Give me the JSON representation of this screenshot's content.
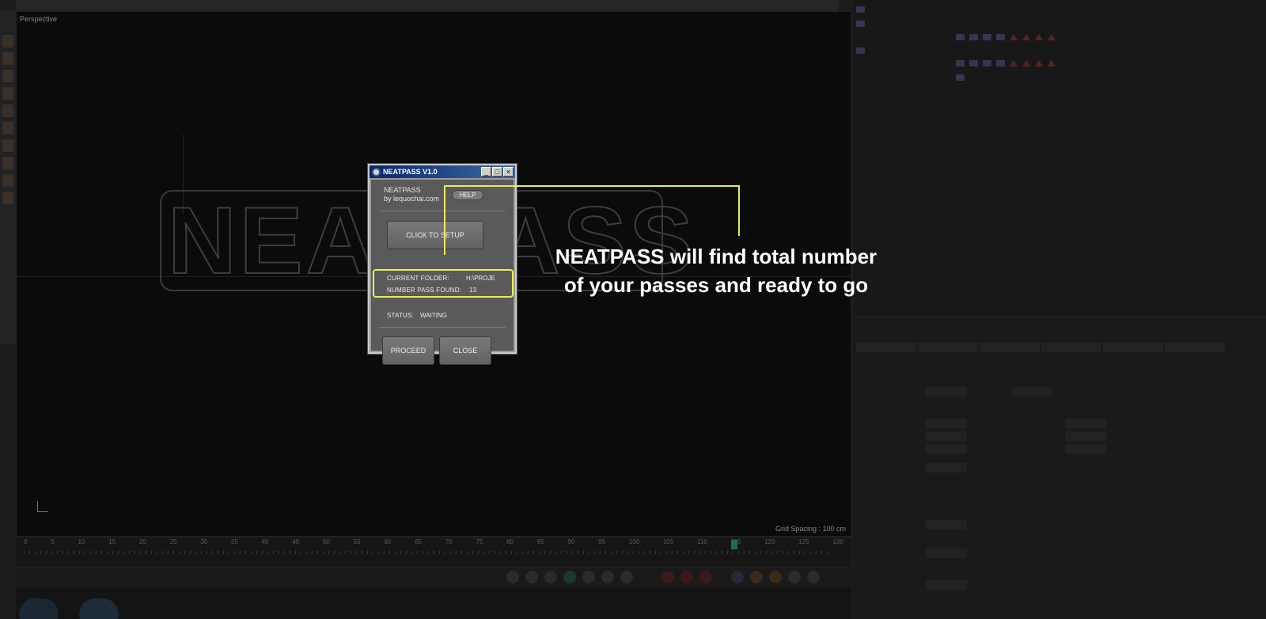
{
  "viewport": {
    "label": "Perspective",
    "grid_spacing": "Grid Spacing : 100 cm"
  },
  "timeline": {
    "ticks": [
      "0",
      "5",
      "10",
      "15",
      "20",
      "25",
      "30",
      "35",
      "40",
      "45",
      "50",
      "55",
      "60",
      "65",
      "70",
      "75",
      "80",
      "85",
      "90",
      "95",
      "100",
      "105",
      "110",
      "115",
      "120",
      "125",
      "130"
    ],
    "current_frame": "114 F"
  },
  "dialog": {
    "title": "NEATPASS V1.0",
    "app_name": "NEATPASS",
    "author": "by lequochai.com",
    "help_label": "HELP",
    "setup_label": "CLICK TO SETUP",
    "current_folder_label": "CURRENT FOLDER:",
    "current_folder_value": "H:\\PROJE",
    "pass_found_label": "NUMBER PASS FOUND:",
    "pass_found_value": "13",
    "status_label": "STATUS:",
    "status_value": "WAITING",
    "proceed_label": "PROCEED",
    "close_label": "CLOSE"
  },
  "caption": {
    "line1": "NEATPASS will find total number",
    "line2": "of your passes and ready to go"
  },
  "colors": {
    "highlight": "#e8ec5a",
    "caption": "#ffffff"
  }
}
